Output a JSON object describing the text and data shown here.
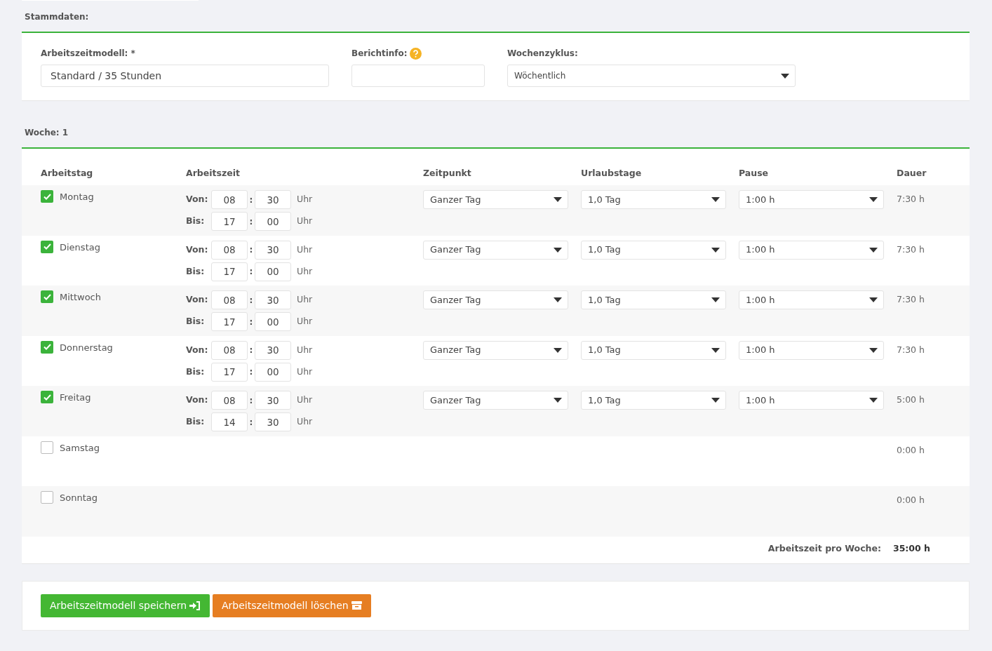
{
  "stammdaten": {
    "heading": "Stammdaten:",
    "fields": [
      {
        "kind": "text",
        "label": "Arbeitszeitmodell: *",
        "value": "Standard / 35 Stunden"
      },
      {
        "kind": "info",
        "label": "Berichtinfo:"
      },
      {
        "kind": "select",
        "label": "Wochenzyklus:",
        "value": "Wöchentlich"
      }
    ]
  },
  "week": {
    "heading": "Woche: 1",
    "columns": [
      "Arbeitstag",
      "Arbeitszeit",
      "Zeitpunkt",
      "Urlaubstage",
      "Pause",
      "Dauer"
    ],
    "days": [
      {
        "name": "Montag",
        "checked": true,
        "times": [
          {
            "label": "Von:",
            "hour": "08",
            "separator": ":",
            "minute": "30",
            "unit": "Uhr"
          },
          {
            "label": "Bis:",
            "hour": "17",
            "separator": ":",
            "minute": "00",
            "unit": "Uhr"
          }
        ],
        "zeitpunkt": "Ganzer Tag",
        "urlaubstage": "1,0 Tag",
        "pause": "1:00 h",
        "dauer": "7:30 h"
      },
      {
        "name": "Dienstag",
        "checked": true,
        "times": [
          {
            "label": "Von:",
            "hour": "08",
            "separator": ":",
            "minute": "30",
            "unit": "Uhr"
          },
          {
            "label": "Bis:",
            "hour": "17",
            "separator": ":",
            "minute": "00",
            "unit": "Uhr"
          }
        ],
        "zeitpunkt": "Ganzer Tag",
        "urlaubstage": "1,0 Tag",
        "pause": "1:00 h",
        "dauer": "7:30 h"
      },
      {
        "name": "Mittwoch",
        "checked": true,
        "times": [
          {
            "label": "Von:",
            "hour": "08",
            "separator": ":",
            "minute": "30",
            "unit": "Uhr"
          },
          {
            "label": "Bis:",
            "hour": "17",
            "separator": ":",
            "minute": "00",
            "unit": "Uhr"
          }
        ],
        "zeitpunkt": "Ganzer Tag",
        "urlaubstage": "1,0 Tag",
        "pause": "1:00 h",
        "dauer": "7:30 h"
      },
      {
        "name": "Donnerstag",
        "checked": true,
        "times": [
          {
            "label": "Von:",
            "hour": "08",
            "separator": ":",
            "minute": "30",
            "unit": "Uhr"
          },
          {
            "label": "Bis:",
            "hour": "17",
            "separator": ":",
            "minute": "00",
            "unit": "Uhr"
          }
        ],
        "zeitpunkt": "Ganzer Tag",
        "urlaubstage": "1,0 Tag",
        "pause": "1:00 h",
        "dauer": "7:30 h"
      },
      {
        "name": "Freitag",
        "checked": true,
        "times": [
          {
            "label": "Von:",
            "hour": "08",
            "separator": ":",
            "minute": "30",
            "unit": "Uhr"
          },
          {
            "label": "Bis:",
            "hour": "14",
            "separator": ":",
            "minute": "30",
            "unit": "Uhr"
          }
        ],
        "zeitpunkt": "Ganzer Tag",
        "urlaubstage": "1,0 Tag",
        "pause": "1:00 h",
        "dauer": "5:00 h"
      },
      {
        "name": "Samstag",
        "checked": false,
        "dauer": "0:00 h"
      },
      {
        "name": "Sonntag",
        "checked": false,
        "dauer": "0:00 h"
      }
    ],
    "total_label": "Arbeitszeit pro Woche:",
    "total_value": "35:00 h"
  },
  "buttons": [
    {
      "kind": "save",
      "label": "Arbeitszeitmodell speichern"
    },
    {
      "kind": "delete",
      "label": "Arbeitszeitmodell löschen"
    }
  ]
}
